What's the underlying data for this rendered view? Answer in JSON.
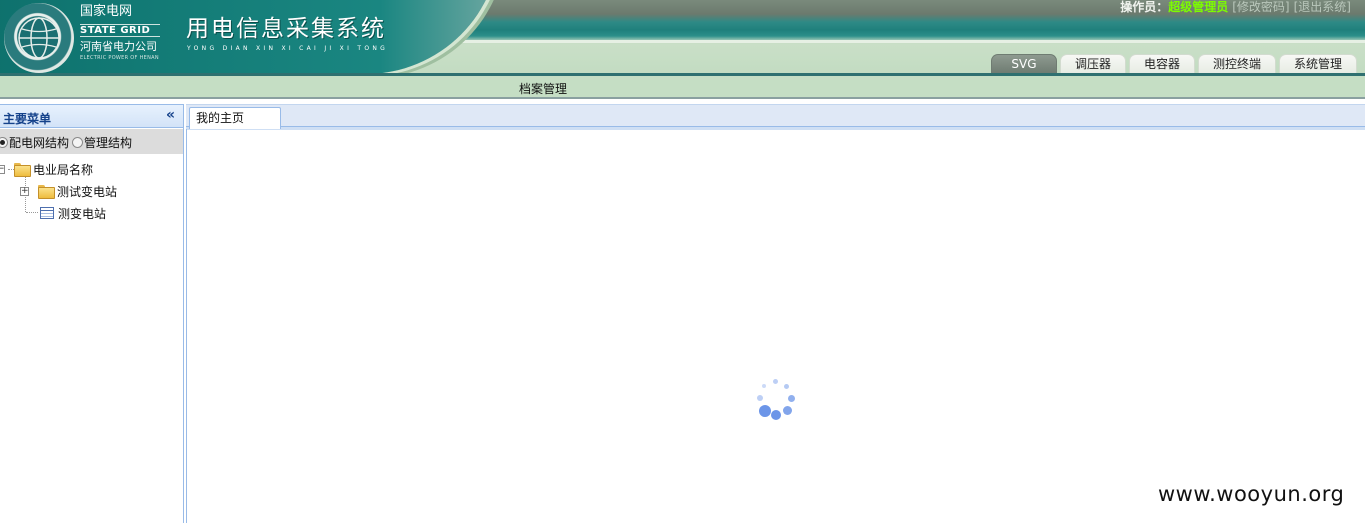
{
  "header": {
    "logo": {
      "cn_name": "国家电网",
      "en_name": "STATE GRID",
      "province": "河南省电力公司",
      "province_en": "ELECTRIC POWER OF HENAN"
    },
    "system_title": "用电信息采集系统",
    "system_pinyin": "YONG DIAN XIN XI CAI JI XI TONG",
    "user": {
      "label": "操作员：",
      "name": "超级管理员",
      "change_password": "[修改密码]",
      "logout": "[退出系统]"
    },
    "tabs": [
      {
        "label": "SVG",
        "active": true
      },
      {
        "label": "调压器",
        "active": false
      },
      {
        "label": "电容器",
        "active": false
      },
      {
        "label": "测控终端",
        "active": false
      },
      {
        "label": "系统管理",
        "active": false
      }
    ]
  },
  "subbar": {
    "label": "档案管理"
  },
  "sidebar": {
    "title": "主要菜单",
    "collapse_icon": "double-chevron-left-icon",
    "radios": [
      {
        "label": "配电网结构",
        "checked": true
      },
      {
        "label": "管理结构",
        "checked": false
      }
    ],
    "tree": {
      "root": "电业局名称",
      "children": [
        {
          "label": "测试变电站",
          "type": "folder",
          "expander": "+"
        },
        {
          "label": "测变电站",
          "type": "table"
        }
      ]
    }
  },
  "main": {
    "tabs": [
      {
        "label": "我的主页"
      }
    ],
    "loading_icon": "loading-spinner-icon"
  },
  "watermark": "www.wooyun.org",
  "colors": {
    "header_teal": "#1a8681",
    "header_green": "#c5dec4",
    "user_name": "#7CFC00",
    "panel_border": "#99bbe8",
    "spinner": "#6c95e8"
  }
}
